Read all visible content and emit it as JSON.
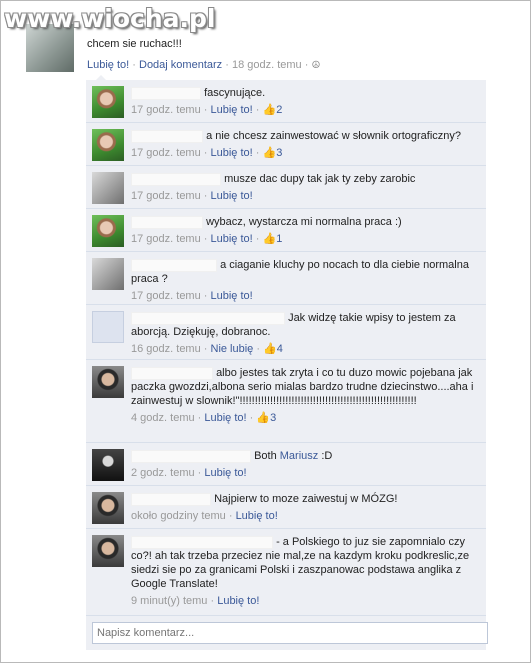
{
  "watermark": "www.wiocha.pl",
  "post": {
    "text": "chcem sie ruchac!!!",
    "like": "Lubię to!",
    "sep": "·",
    "comment": "Dodaj komentarz",
    "time": "18 godz. temu",
    "audience_icon": "friends-icon"
  },
  "comments": [
    {
      "text": "fascynujące.",
      "time": "17 godz. temu",
      "like": "Lubię to!",
      "likes": "2"
    },
    {
      "text": "a nie chcesz zainwestować w słownik ortograficzny?",
      "time": "17 godz. temu",
      "like": "Lubię to!",
      "likes": "3"
    },
    {
      "text": "musze dac dupy tak jak ty zeby zarobic",
      "time": "17 godz. temu",
      "like": "Lubię to!",
      "likes": ""
    },
    {
      "text": "wybacz, wystarcza mi normalna praca :)",
      "time": "17 godz. temu",
      "like": "Lubię to!",
      "likes": "1"
    },
    {
      "text": "a ciaganie kluchy po nocach to dla ciebie normalna praca ?",
      "time": "17 godz. temu",
      "like": "Lubię to!",
      "likes": ""
    },
    {
      "text": "Jak widzę takie wpisy to jestem za aborcją. Dziękuję, dobranoc.",
      "time": "16 godz. temu",
      "like": "Nie lubię",
      "likes": "4"
    },
    {
      "text": "albo jestes tak zryta i co tu duzo mowic pojebana jak paczka gwozdzi,albona serio mialas bardzo trudne dziecinstwo....aha i zainwestuj w slownik!\"!!!!!!!!!!!!!!!!!!!!!!!!!!!!!!!!!!!!!!!!!!!!!!!!!!!!!!!!!!",
      "time": "4 godz. temu",
      "like": "Lubię to!",
      "likes": "3"
    },
    {
      "text": "Both",
      "mention": "Mariusz",
      "after": ":D",
      "time": "2 godz. temu",
      "like": "Lubię to!",
      "likes": ""
    },
    {
      "text": "Najpierw to moze zaiwestuj w MÓZG!",
      "time": "około godziny temu",
      "like": "Lubię to!",
      "likes": ""
    },
    {
      "text": "- a Polskiego to juz sie zapomnialo czy co?! ah tak trzeba przeciez nie mal,ze na kazdym kroku podkreslic,ze siedzi sie po za granicami Polski i zaszpanowac podstawa anglika z Google Translate!",
      "time": "9 minut(y) temu",
      "like": "Lubię to!",
      "likes": ""
    }
  ],
  "input": {
    "placeholder": "Napisz komentarz..."
  },
  "icons": {
    "thumb": "thumbs-up-icon"
  },
  "colors": {
    "link": "#3b5998",
    "meta": "#999999",
    "thread_bg": "#edeff4"
  }
}
